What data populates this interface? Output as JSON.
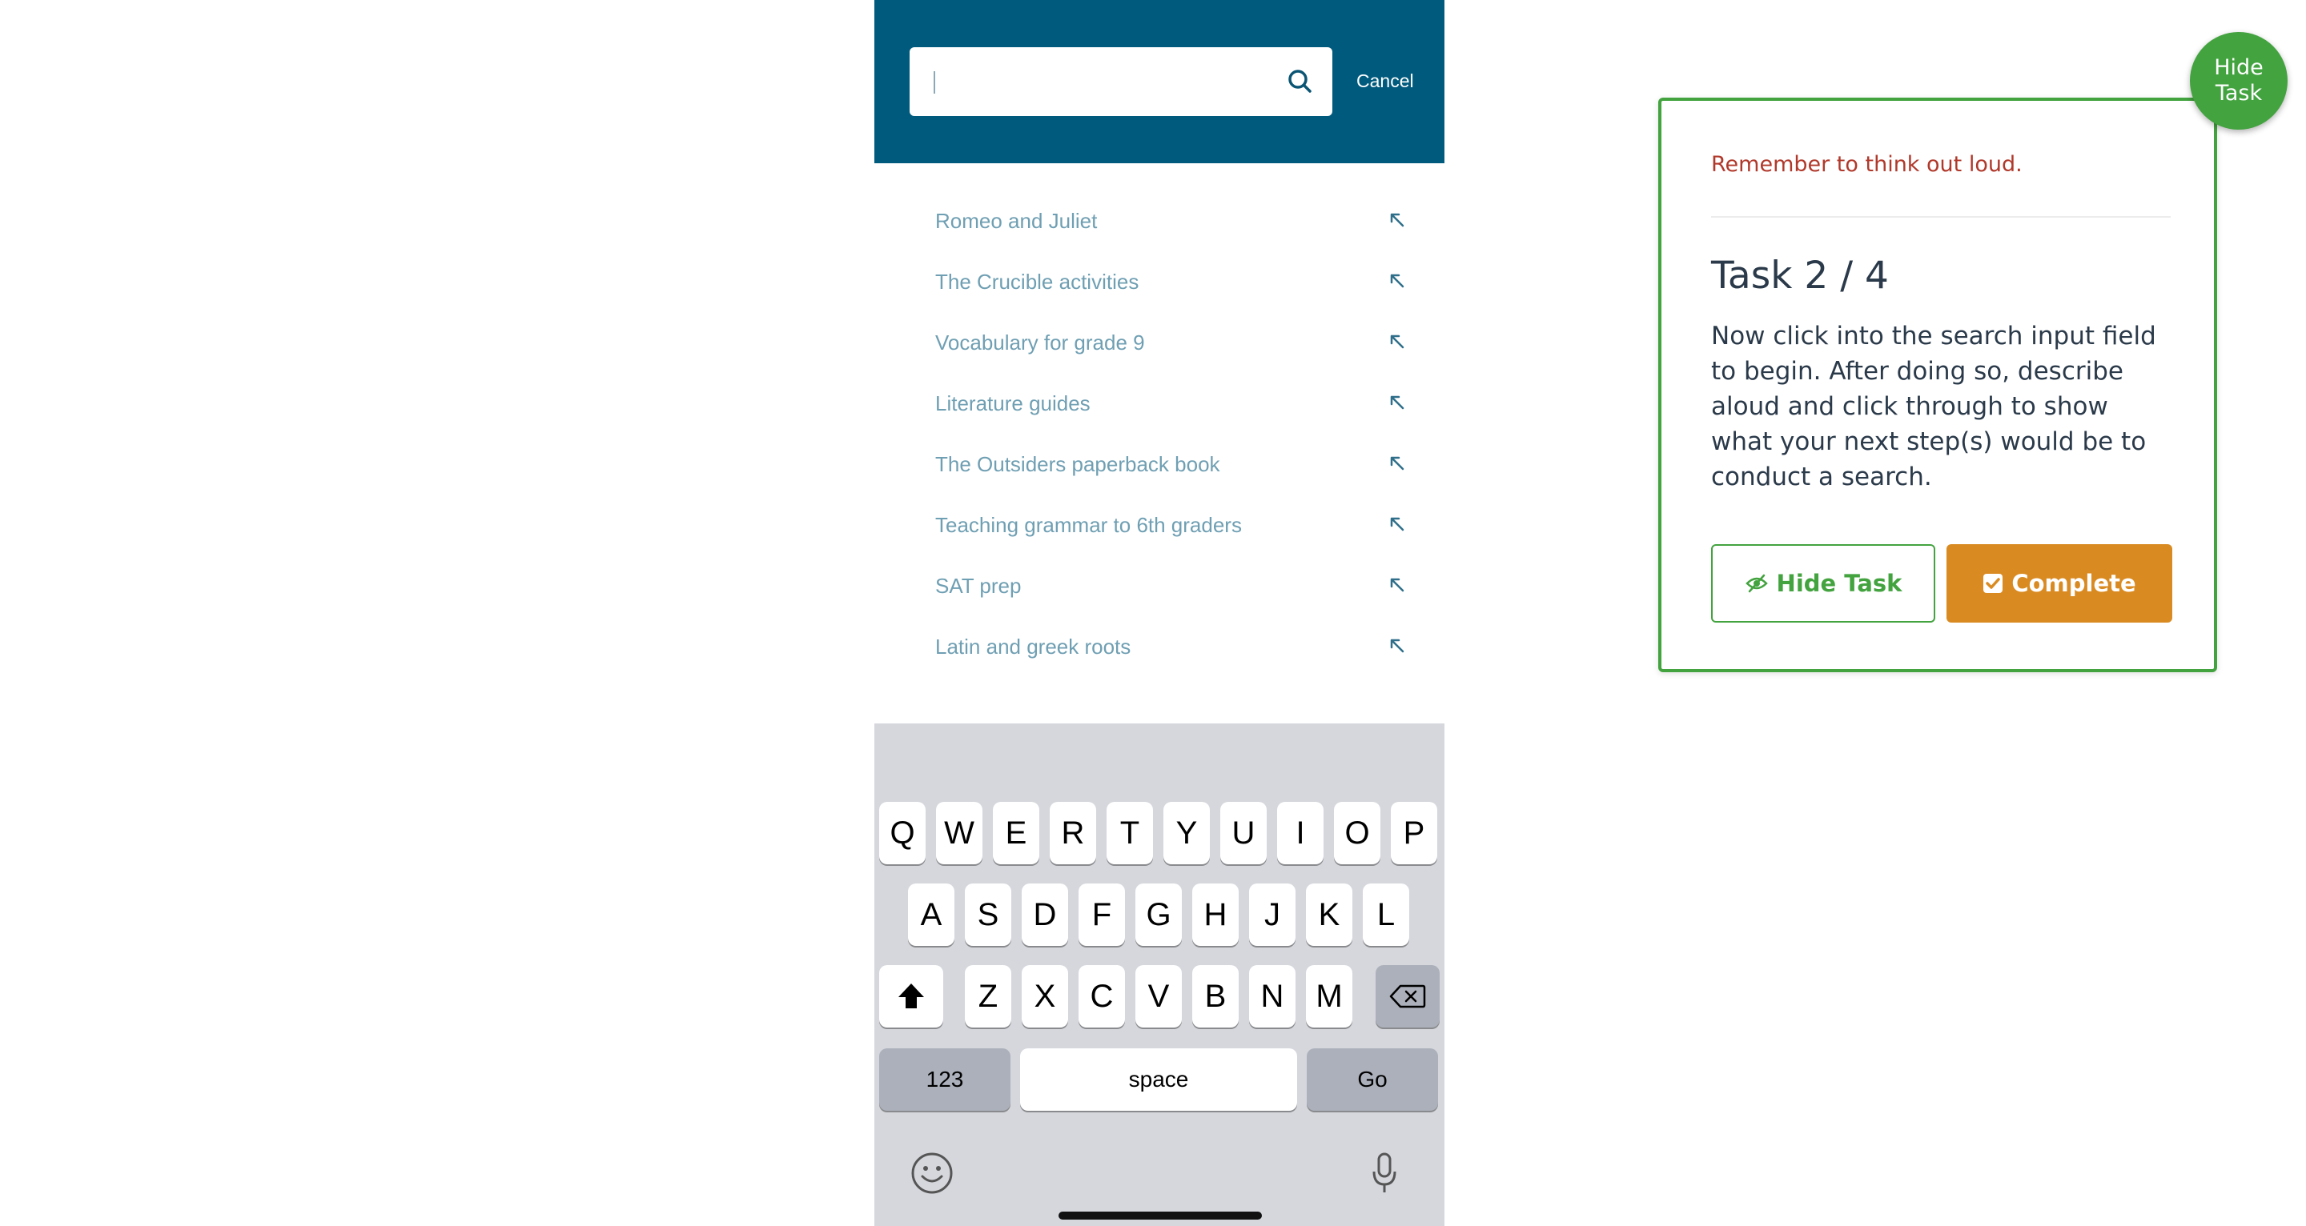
{
  "search": {
    "placeholder": "",
    "cancel_label": "Cancel"
  },
  "suggestions": [
    "Romeo and Juliet",
    "The Crucible activities",
    "Vocabulary for grade 9",
    "Literature guides",
    "The Outsiders paperback book",
    "Teaching grammar to 6th graders",
    "SAT prep",
    "Latin and greek roots"
  ],
  "keyboard": {
    "row1": [
      "Q",
      "W",
      "E",
      "R",
      "T",
      "Y",
      "U",
      "I",
      "O",
      "P"
    ],
    "row2": [
      "A",
      "S",
      "D",
      "F",
      "G",
      "H",
      "J",
      "K",
      "L"
    ],
    "row3": [
      "Z",
      "X",
      "C",
      "V",
      "B",
      "N",
      "M"
    ],
    "numbers_label": "123",
    "space_label": "space",
    "go_label": "Go"
  },
  "task": {
    "reminder": "Remember to think out loud.",
    "title": "Task 2 / 4",
    "description": "Now click into the search input field to begin. After doing so, describe aloud and click through to show what your next step(s) would be to conduct a search.",
    "hide_button_label": "Hide Task",
    "complete_button_label": "Complete",
    "float_button_line1": "Hide",
    "float_button_line2": "Task"
  },
  "colors": {
    "header_blue": "#005a7d",
    "suggestion_text": "#6f9fb3",
    "task_green": "#43a33f",
    "complete_orange": "#d98b22",
    "reminder_red": "#b0392b"
  }
}
